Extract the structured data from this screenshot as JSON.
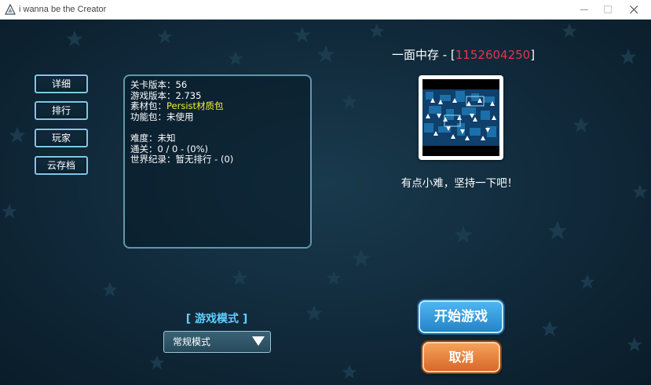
{
  "window": {
    "title": "i wanna be the Creator"
  },
  "side_menu": {
    "items": [
      {
        "label": "详细"
      },
      {
        "label": "排行"
      },
      {
        "label": "玩家"
      },
      {
        "label": "云存档"
      }
    ]
  },
  "info": {
    "level_version_label": "关卡版本：",
    "level_version_value": "56",
    "game_version_label": "游戏版本：",
    "game_version_value": "2.735",
    "asset_pack_label": "素材包：",
    "asset_pack_value": "Persist材质包",
    "function_pack_label": "功能包：",
    "function_pack_value": "未使用",
    "difficulty_label": "难度：",
    "difficulty_value": "未知",
    "clears_label": "通关：",
    "clears_value": "0 / 0 - (0%)",
    "world_record_label": "世界纪录：",
    "world_record_value": "暂无排行 - (0)"
  },
  "level": {
    "name": "一面中存",
    "id": "1152604250",
    "description": "有点小难，坚持一下吧！"
  },
  "mode": {
    "label": "[ 游戏模式 ]",
    "selected": "常规模式"
  },
  "actions": {
    "start_label": "开始游戏",
    "cancel_label": "取消"
  },
  "colors": {
    "accent_cyan": "#5fd0ff",
    "level_id_red": "#e2364b",
    "asset_pack_yellow": "#f2ef35",
    "start_button": "#3a9fe0",
    "cancel_button": "#e47d3a"
  }
}
